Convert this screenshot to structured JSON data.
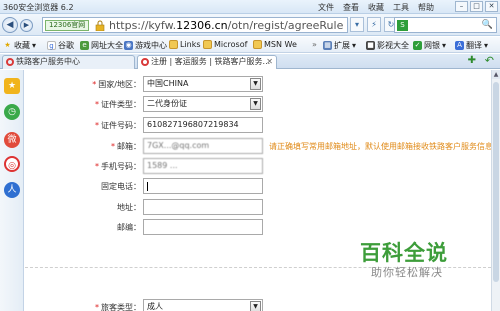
{
  "window": {
    "title": "360安全浏览器 6.2",
    "menu": [
      "文件",
      "查看",
      "收藏",
      "工具",
      "帮助"
    ],
    "controls": [
      "min",
      "max",
      "close"
    ]
  },
  "addressbar": {
    "site_badge": "12306官网",
    "url_prefix": "https://kyfw.",
    "url_domain": "12306.cn",
    "url_path": "/otn/regist/agreeRule"
  },
  "bookmarks": {
    "items": [
      "收藏",
      "谷歌",
      "网址大全",
      "游戏中心",
      "Links",
      "Microsof",
      "MSN We"
    ],
    "right_items": [
      "扩展",
      "影视大全",
      "网银",
      "翻译"
    ]
  },
  "tabs": [
    {
      "label": "铁路客户服务中心",
      "active": false
    },
    {
      "label": "注册 | 客运服务 | 铁路客户服务...",
      "active": true
    }
  ],
  "form": {
    "rows": [
      {
        "label": "国家/地区：",
        "required": true,
        "value": "中国CHINA",
        "type": "select"
      },
      {
        "label": "证件类型：",
        "required": true,
        "value": "二代身份证",
        "type": "select"
      },
      {
        "label": "证件号码：",
        "required": true,
        "value": "610827196807219834",
        "type": "text"
      },
      {
        "label": "邮箱：",
        "required": true,
        "value": "7GX...@qq.com",
        "type": "text",
        "hint": "请正确填写常用邮箱地址，默认使用邮箱接收铁路客户服务信息"
      },
      {
        "label": "手机号码：",
        "required": true,
        "value": "1589 ...",
        "type": "text"
      },
      {
        "label": "固定电话：",
        "required": false,
        "value": "",
        "type": "text"
      },
      {
        "label": "地址：",
        "required": false,
        "value": "",
        "type": "text"
      },
      {
        "label": "邮编：",
        "required": false,
        "value": "",
        "type": "text"
      },
      {
        "label": "旅客类型：",
        "required": true,
        "value": "成人",
        "type": "select"
      }
    ]
  },
  "watermark": {
    "brand": "百科全说",
    "tagline": "助你轻松解决"
  }
}
